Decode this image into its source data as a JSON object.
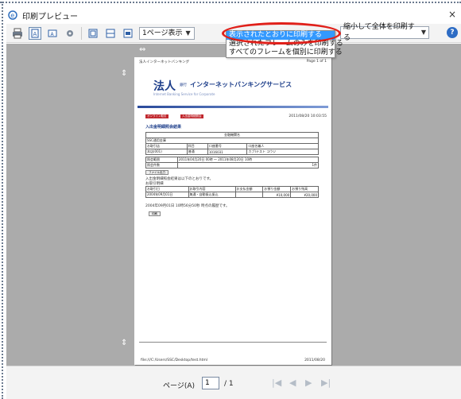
{
  "window": {
    "title": "印刷プレビュー",
    "close": "×"
  },
  "toolbar": {
    "icons": [
      "printer-icon",
      "portrait-icon",
      "landscape-icon",
      "page-setup-icon",
      "toggle-header-icon",
      "single-page-icon",
      "fullwidth-icon"
    ],
    "view_select": "1ページ表示",
    "shrink_select": "縮小して全体を印刷する",
    "help": "?"
  },
  "frames_dropdown": {
    "options": [
      "表示されたとおりに印刷する",
      "選択されたフレームのみを印刷する",
      "すべてのフレームを個別に印刷する"
    ],
    "selected_index": 0
  },
  "page": {
    "header_left": "法人インターネットバンキング",
    "header_right": "Page 1 of 1",
    "logo": "法人",
    "bank_small": "銀行",
    "service_name": "インターネットバンキングサービス",
    "service_sub": "Internet Banking Service for Corporate",
    "tag1": "オンライン取引",
    "tag2": "入出金明細照会",
    "datetime": "2011/08/20 10:03:55",
    "heading": "入出金明細照会結果",
    "account_table": {
      "title": "金融機関名",
      "rows": [
        [
          "SSC通用金庫",
          "",
          "",
          "",
          ""
        ],
        [
          "お取引店",
          "科目",
          "口座番号",
          "口座名義人",
          ""
        ],
        [
          "本店(001)",
          "普通",
          "1016031",
          "カブ)テスト コウジ",
          ""
        ]
      ]
    },
    "period_label": "照会範囲",
    "period_value": "2011年04月20日 00時 ～ 2011年08月20日 10時",
    "count_label": "照会件数",
    "count_value": "1件",
    "file_button": "ファイル出力",
    "result_text": "入出金明細照会結果は以下のとおりです。",
    "detail_title": "お取引明細",
    "detail_headers": [
      "お取引日",
      "お取引内容",
      "お支払金額",
      "お預り金額",
      "お預り残高"
    ],
    "detail_row": [
      "2004年09月01日",
      "無通・自動振込振込",
      "",
      "¥10,000",
      "¥20,000"
    ],
    "footer_text": "2004年09月01日 10時56分50秒 時点の履歴です。",
    "print_button": "印刷",
    "footer_path": "file:///C:/Users/SSC/Desktop/test.html",
    "footer_date": "2011/08/20"
  },
  "statusbar": {
    "label": "ページ(A)",
    "current": "1",
    "total": "/ 1",
    "nav": [
      "first-icon",
      "prev-icon",
      "next-icon",
      "last-icon"
    ]
  },
  "colors": {
    "highlight": "#3399ff",
    "annotation": "#e0201a",
    "preview_bg": "#ababab"
  }
}
